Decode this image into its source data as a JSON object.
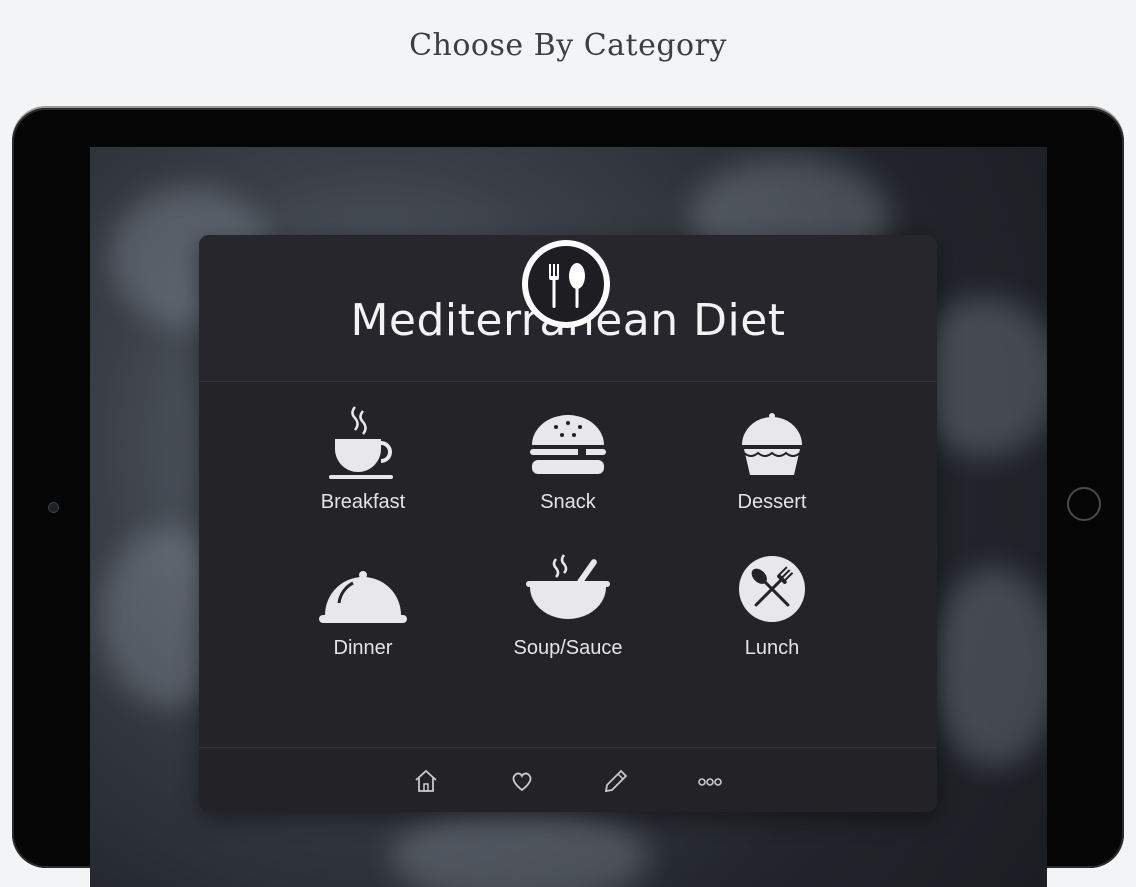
{
  "promo": {
    "title": "Choose By Category"
  },
  "app": {
    "title": "Mediterranean Diet",
    "logo_icon": "fork-spoon-icon"
  },
  "categories": [
    {
      "label": "Breakfast",
      "icon": "coffee-cup-icon"
    },
    {
      "label": "Snack",
      "icon": "burger-icon"
    },
    {
      "label": "Dessert",
      "icon": "cupcake-icon"
    },
    {
      "label": "Dinner",
      "icon": "cloche-icon"
    },
    {
      "label": "Soup/Sauce",
      "icon": "soup-bowl-icon"
    },
    {
      "label": "Lunch",
      "icon": "fork-spoon-crossed-icon"
    }
  ],
  "tabbar": {
    "items": [
      {
        "icon": "home-icon"
      },
      {
        "icon": "heart-icon"
      },
      {
        "icon": "pencil-icon"
      },
      {
        "icon": "more-icon"
      }
    ]
  },
  "colors": {
    "page_background": "#f2f4f5",
    "card_background": "#232328",
    "text_light": "#e4e4e6",
    "icon_fill": "#e8e8ea"
  }
}
